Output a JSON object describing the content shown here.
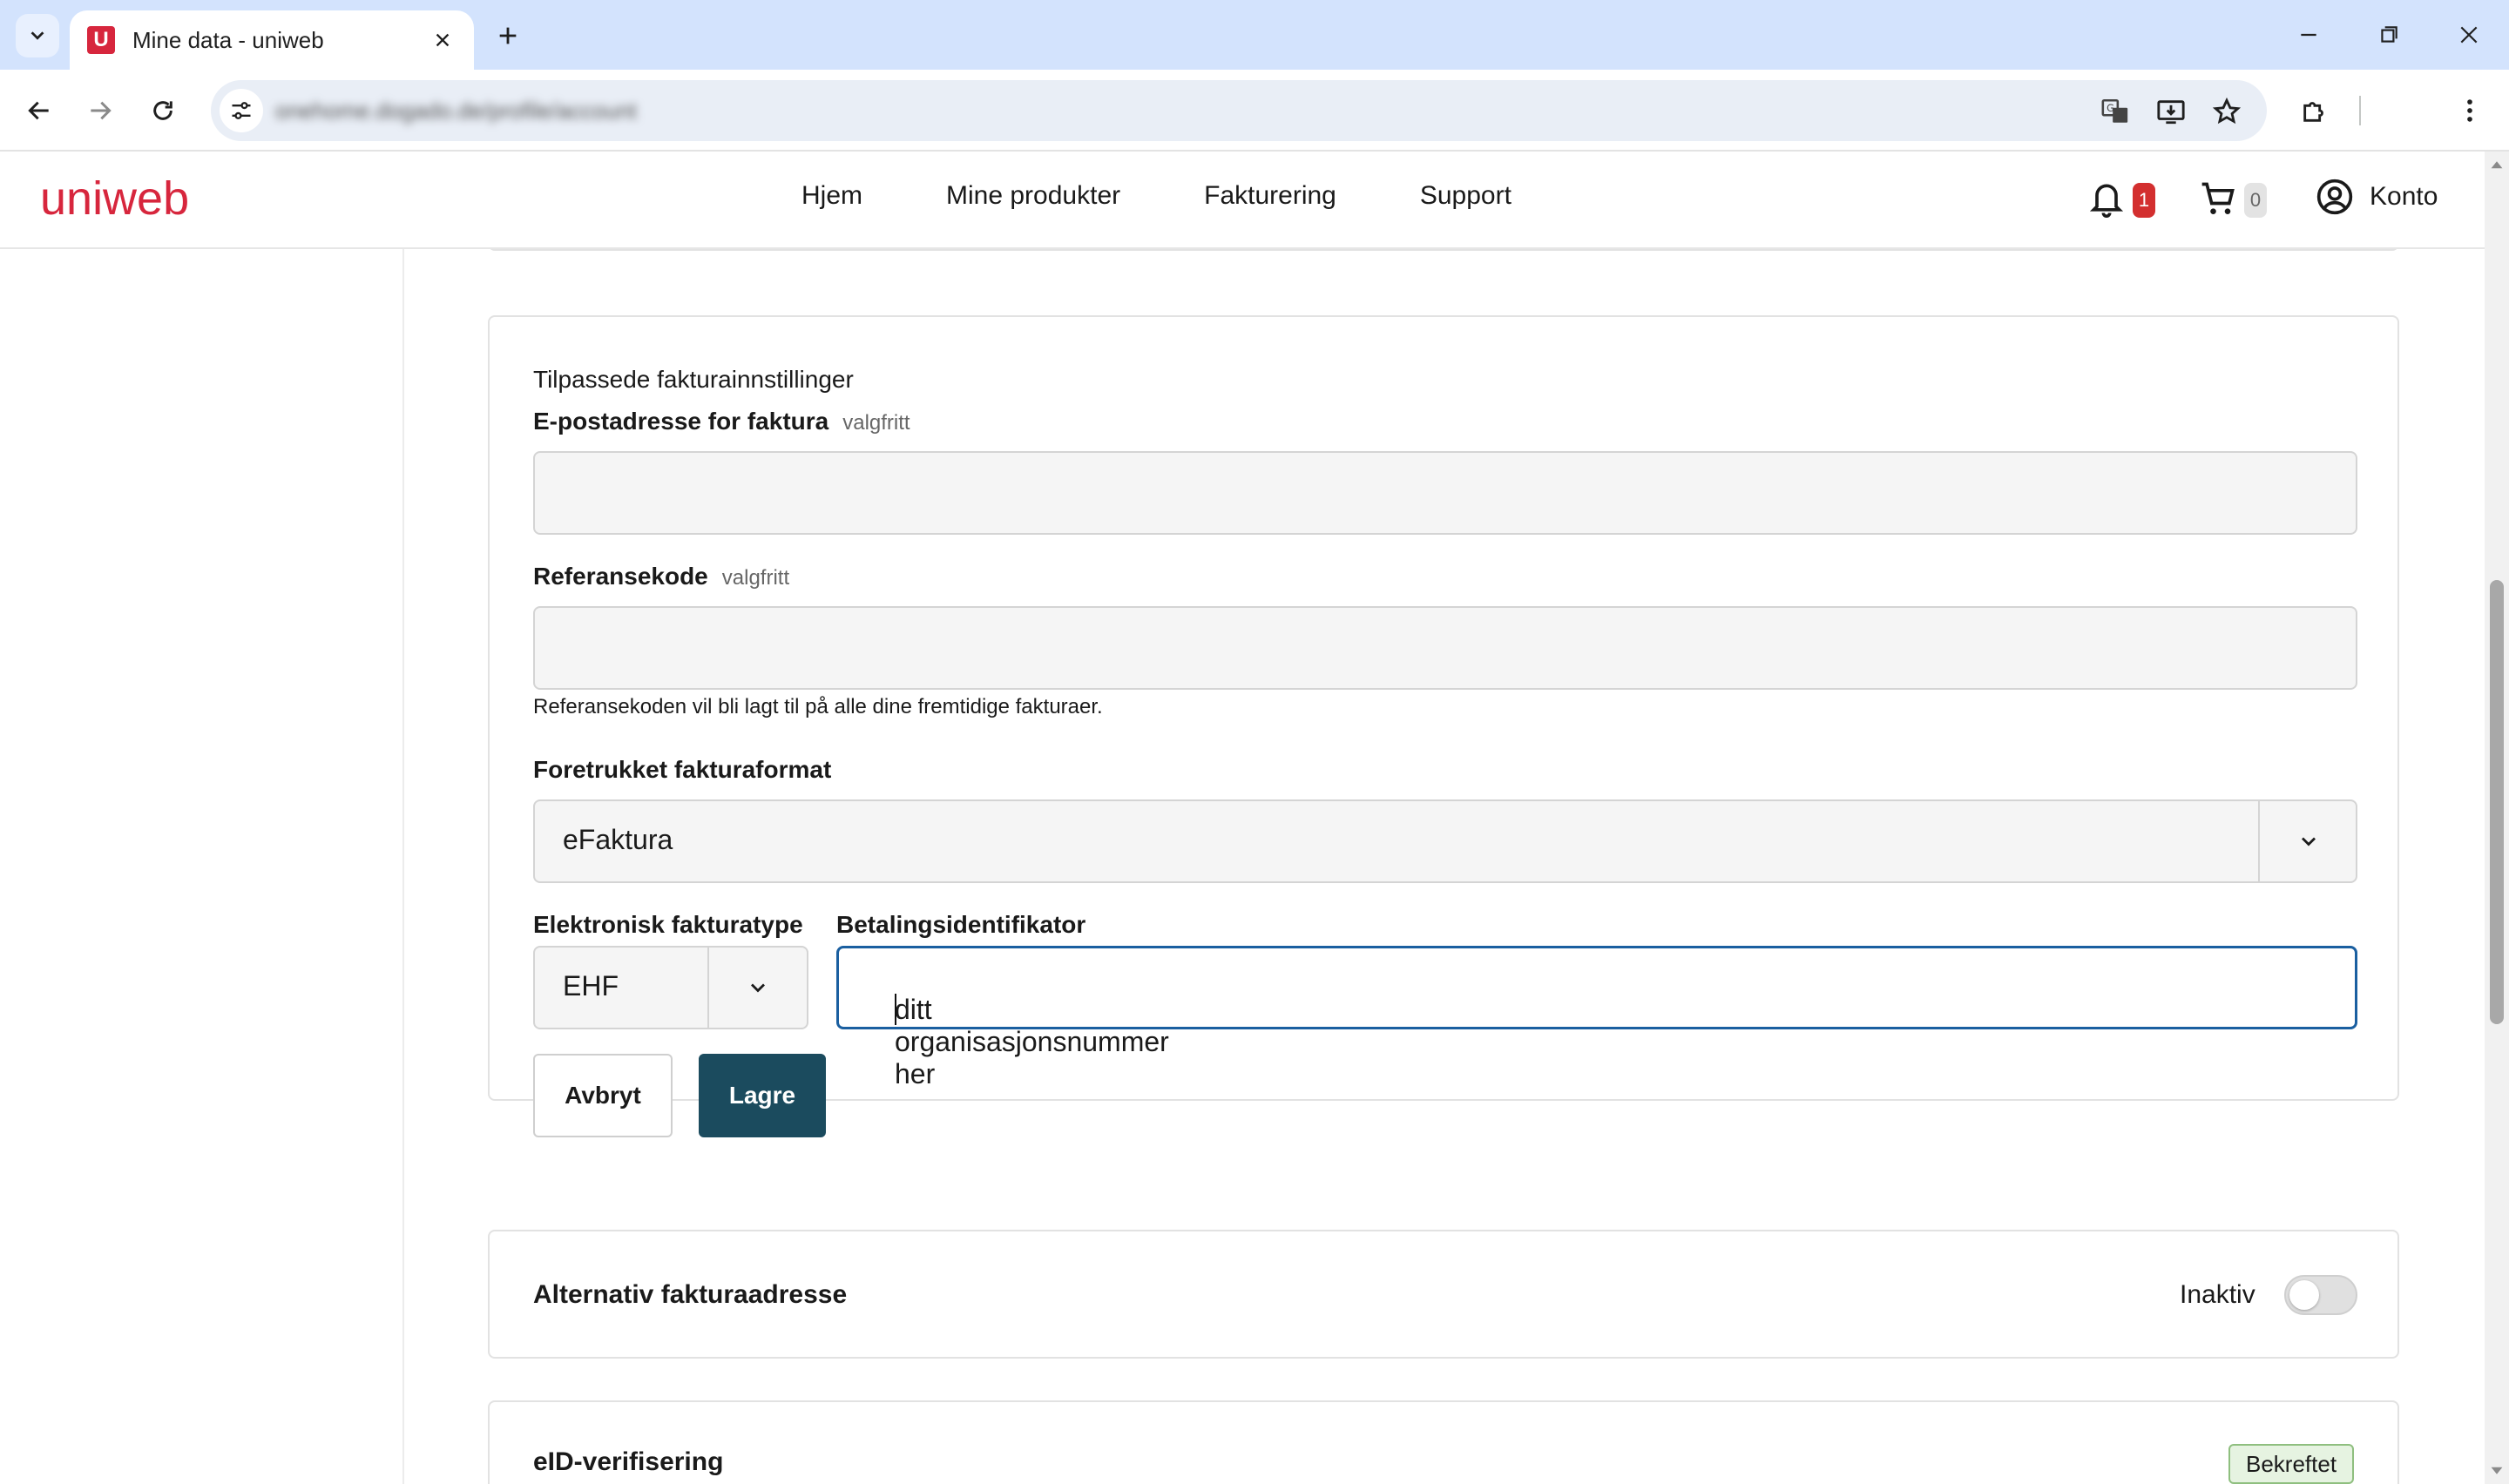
{
  "browser": {
    "tab_title": "Mine data - uniweb",
    "favicon_letter": "U",
    "url": "onehome.dogado.de/profile/account"
  },
  "header": {
    "logo_text": "uniweb",
    "nav": [
      "Hjem",
      "Mine produkter",
      "Fakturering",
      "Support"
    ],
    "notifications_count": "1",
    "cart_count": "0",
    "account_label": "Konto"
  },
  "settings": {
    "section_title": "Tilpassede fakturainnstillinger",
    "email_label": "E-postadresse for faktura",
    "email_optional": "valgfritt",
    "email_value": "",
    "reference_label": "Referansekode",
    "reference_optional": "valgfritt",
    "reference_value": "",
    "reference_helper": "Referansekoden vil bli lagt til på alle dine fremtidige fakturaer.",
    "format_label": "Foretrukket fakturaformat",
    "format_value": "eFaktura",
    "etype_label": "Elektronisk fakturatype",
    "etype_value": "EHF",
    "payid_label": "Betalingsidentifikator",
    "payid_value": "ditt organisasjonsnummer her",
    "cancel_label": "Avbryt",
    "save_label": "Lagre"
  },
  "alt_address": {
    "title": "Alternativ fakturaadresse",
    "state": "Inaktiv",
    "enabled": false
  },
  "eid": {
    "title": "eID-verifisering",
    "badge": "Bekreftet"
  },
  "colors": {
    "brand_red": "#d7263d",
    "save_button": "#1b4b5e",
    "focus_border": "#1a5fa0",
    "verified_bg": "#e6f3e1"
  }
}
